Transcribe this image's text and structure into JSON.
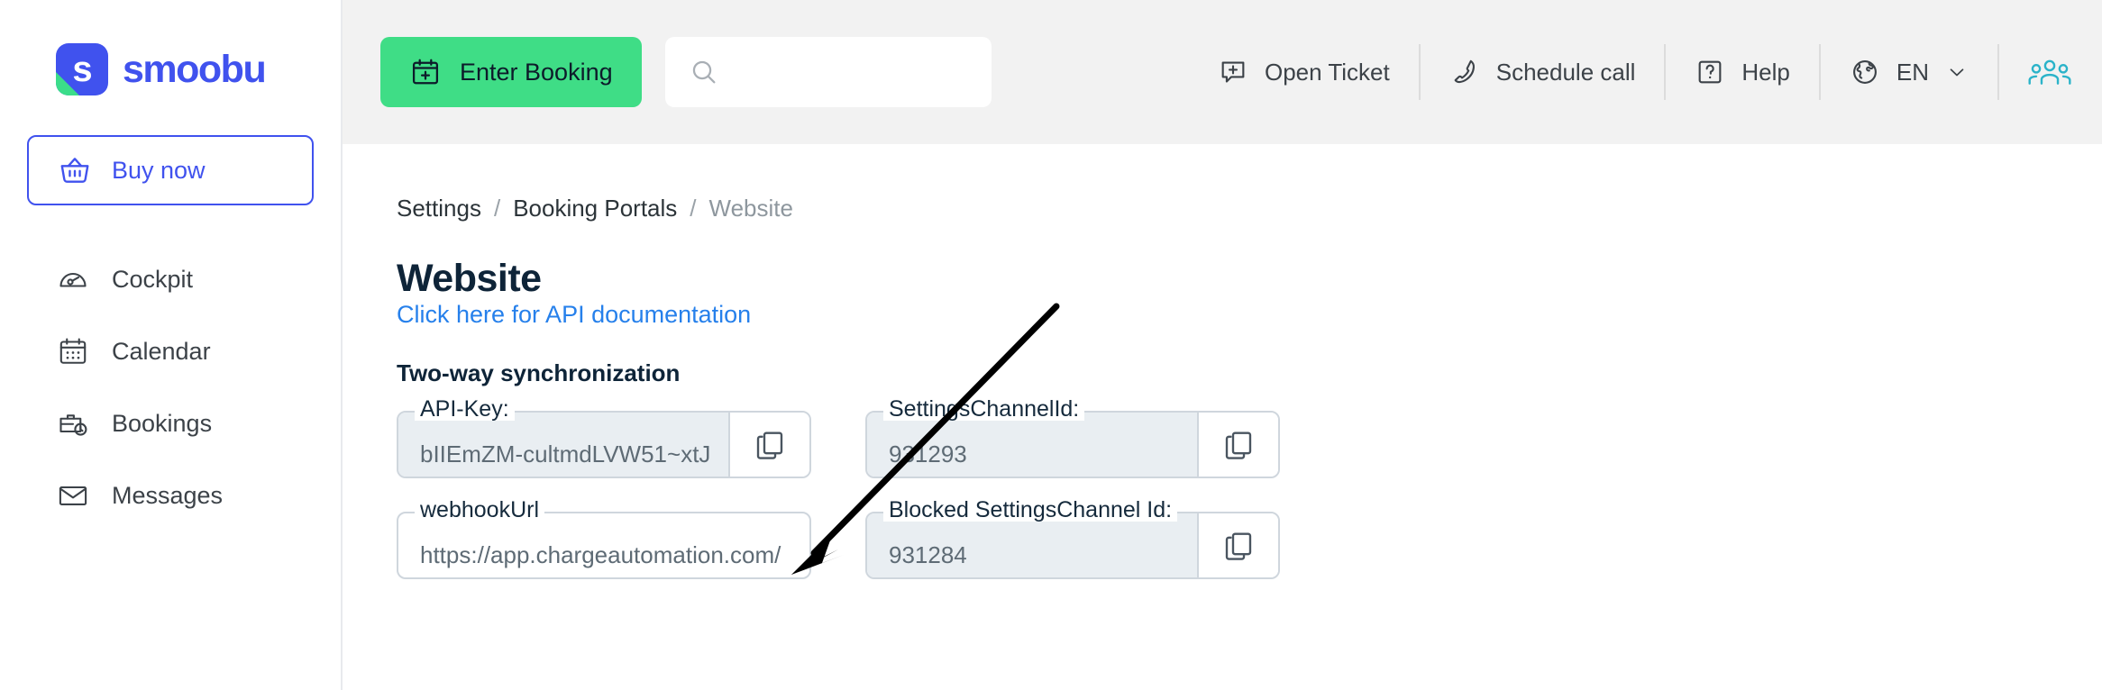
{
  "brand": {
    "name": "smoobu",
    "logo_letter": "s",
    "logo_blue": "#4052EE",
    "logo_green": "#3BDD8A"
  },
  "sidebar": {
    "buy_now": {
      "label": "Buy now",
      "icon": "basket-icon",
      "color": "#4052EE"
    },
    "items": [
      {
        "label": "Cockpit",
        "icon": "speedometer-icon"
      },
      {
        "label": "Calendar",
        "icon": "calendar-icon"
      },
      {
        "label": "Bookings",
        "icon": "briefcase-clock-icon"
      },
      {
        "label": "Messages",
        "icon": "envelope-icon"
      }
    ]
  },
  "topbar": {
    "enter_booking_label": "Enter Booking",
    "enter_booking_icon": "calendar-plus-icon",
    "enter_booking_color": "#3FDD86",
    "search_value": "",
    "search_placeholder": "",
    "search_icon": "search-icon",
    "actions": [
      {
        "label": "Open Ticket",
        "icon": "ticket-plus-icon"
      },
      {
        "label": "Schedule call",
        "icon": "phone-icon"
      },
      {
        "label": "Help",
        "icon": "question-box-icon"
      }
    ],
    "language": {
      "label": "EN",
      "icon": "globe-icon",
      "chevron": "chevron-down-icon"
    },
    "people_icon": "people-group-icon",
    "people_icon_color": "#2BB3C9"
  },
  "breadcrumb": {
    "items": [
      "Settings",
      "Booking Portals",
      "Website"
    ],
    "separator": "/"
  },
  "page": {
    "title": "Website",
    "api_doc_link": "Click here for API documentation",
    "section_title": "Two-way synchronization"
  },
  "fields": [
    {
      "name": "api-key",
      "label": "API-Key:",
      "value": "bIIEmZM-cultmdLVW51~xtJ",
      "filled": true,
      "copy": true,
      "copy_icon": "copy-icon"
    },
    {
      "name": "settings-channel-id",
      "label": "SettingsChannelId:",
      "value": "931293",
      "filled": true,
      "copy": true,
      "copy_icon": "copy-icon"
    },
    {
      "name": "webhook-url",
      "label": "webhookUrl",
      "value": "https://app.chargeautomation.com/",
      "filled": false,
      "copy": false,
      "copy_icon": ""
    },
    {
      "name": "blocked-settings-channel-id",
      "label": "Blocked SettingsChannel Id:",
      "value": "931284",
      "filled": true,
      "copy": true,
      "copy_icon": "copy-icon"
    }
  ],
  "annotation": {
    "type": "arrow",
    "color": "#000000",
    "points_to": "webhook-url"
  }
}
